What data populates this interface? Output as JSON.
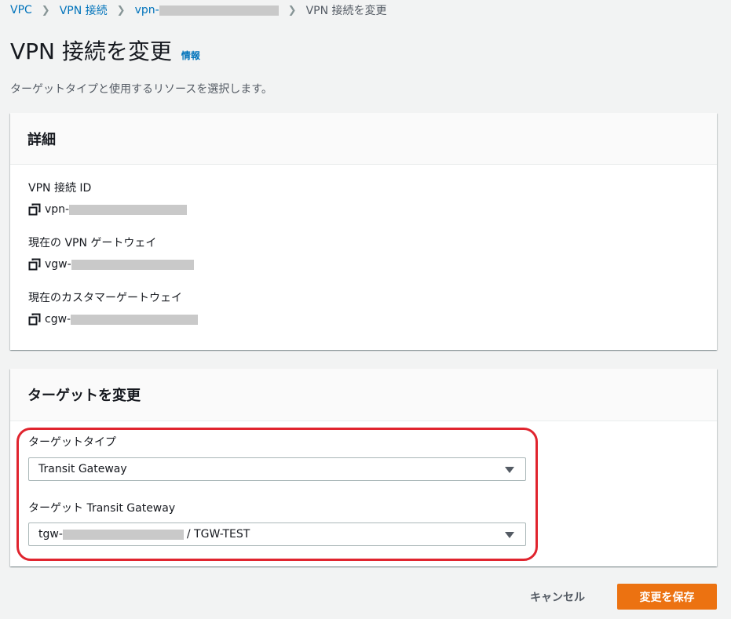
{
  "breadcrumb": {
    "items": [
      "VPC",
      "VPN 接続",
      "vpn-",
      "VPN 接続を変更"
    ]
  },
  "header": {
    "title": "VPN 接続を変更",
    "info_link": "情報",
    "description": "ターゲットタイプと使用するリソースを選択します。"
  },
  "details": {
    "heading": "詳細",
    "fields": [
      {
        "label": "VPN 接続 ID",
        "value_prefix": "vpn-"
      },
      {
        "label": "現在の VPN ゲートウェイ",
        "value_prefix": "vgw-"
      },
      {
        "label": "現在のカスタマーゲートウェイ",
        "value_prefix": "cgw-"
      }
    ]
  },
  "target": {
    "heading": "ターゲットを変更",
    "type_label": "ターゲットタイプ",
    "type_value": "Transit Gateway",
    "tgw_label": "ターゲット Transit Gateway",
    "tgw_prefix": "tgw-",
    "tgw_suffix": "/ TGW-TEST"
  },
  "actions": {
    "cancel": "キャンセル",
    "save": "変更を保存"
  },
  "colors": {
    "link": "#0073bb",
    "primary_button": "#ec7211",
    "highlight": "#e0242e",
    "background": "#f2f3f3"
  },
  "icons": [
    "chevron-right-icon",
    "copy-icon",
    "caret-down-icon"
  ]
}
